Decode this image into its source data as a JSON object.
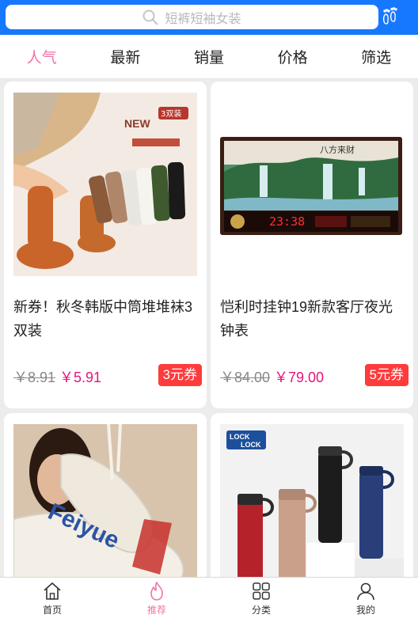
{
  "search": {
    "placeholder": "短裤短袖女装"
  },
  "tabs": [
    {
      "label": "人气",
      "active": true
    },
    {
      "label": "最新"
    },
    {
      "label": "销量"
    },
    {
      "label": "价格"
    },
    {
      "label": "筛选"
    }
  ],
  "products": [
    {
      "title": "新券！秋冬韩版中筒堆堆袜3双装",
      "old_price": "￥8.91",
      "price": "￥5.91",
      "coupon": "3元券"
    },
    {
      "title": "恺利时挂钟19新款客厅夜光钟表",
      "old_price": "￥84.00",
      "price": "￥79.00",
      "coupon": "5元券"
    },
    {
      "title": "",
      "old_price": "",
      "price": "",
      "coupon": ""
    },
    {
      "title": "",
      "old_price": "",
      "price": "",
      "coupon": ""
    }
  ],
  "image_text": {
    "socks_new": "NEW",
    "socks_pack": "3双装",
    "clock_brand": "八方来财",
    "clock_time": "23:38",
    "shoe_brand": "Feiyue",
    "bottle_brand_top": "LOCK",
    "bottle_brand_bottom": "LOCK"
  },
  "bottom_nav": [
    {
      "label": "首页",
      "icon": "home-icon"
    },
    {
      "label": "推荐",
      "icon": "flame-icon",
      "active": true
    },
    {
      "label": "分类",
      "icon": "grid-icon"
    },
    {
      "label": "我的",
      "icon": "user-icon"
    }
  ],
  "colors": {
    "brand": "#1677ff",
    "accent": "#f472a7",
    "price": "#e6157a",
    "coupon": "#ff3b3b"
  }
}
